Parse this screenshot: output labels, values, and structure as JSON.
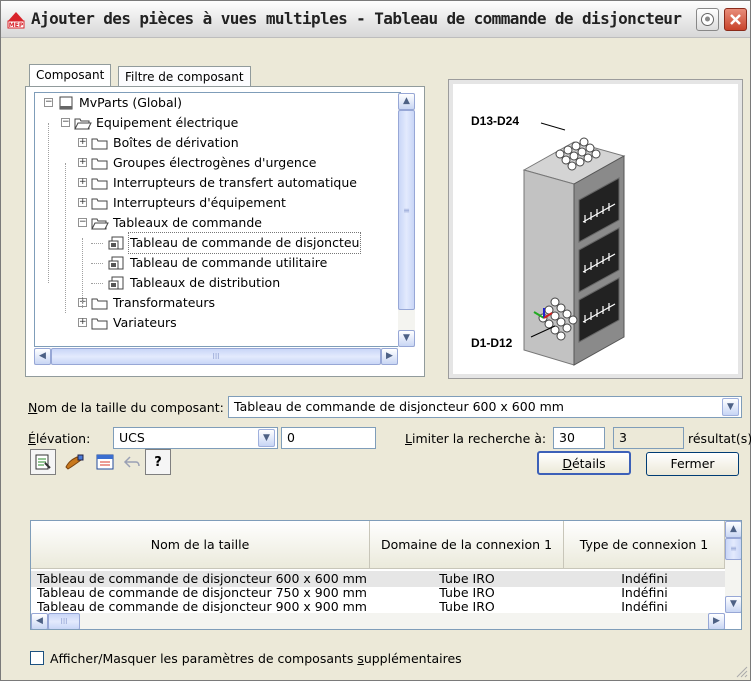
{
  "window": {
    "title": "Ajouter des pièces à vues multiples - Tableau de commande de disjoncteur",
    "app_badge": "MEP"
  },
  "tabs": [
    {
      "label": "Composant",
      "selected": true
    },
    {
      "label": "Filtre de composant",
      "selected": false
    }
  ],
  "tree": {
    "nodes": [
      {
        "label": "MvParts (Global)",
        "depth": 0,
        "expander": "minus",
        "icon": "drive-icon"
      },
      {
        "label": "Equipement électrique",
        "depth": 1,
        "expander": "minus",
        "icon": "folder-open-icon"
      },
      {
        "label": "Boîtes de dérivation",
        "depth": 2,
        "expander": "plus",
        "icon": "folder-icon"
      },
      {
        "label": "Groupes électrogènes d'urgence",
        "depth": 2,
        "expander": "plus",
        "icon": "folder-icon"
      },
      {
        "label": "Interrupteurs de transfert automatique",
        "depth": 2,
        "expander": "plus",
        "icon": "folder-icon"
      },
      {
        "label": "Interrupteurs d'équipement",
        "depth": 2,
        "expander": "plus",
        "icon": "folder-icon"
      },
      {
        "label": "Tableaux de commande",
        "depth": 2,
        "expander": "minus",
        "icon": "folder-open-icon"
      },
      {
        "label": "Tableau de commande de disjoncteu",
        "depth": 3,
        "expander": "",
        "icon": "part-icon",
        "selected": true
      },
      {
        "label": "Tableau de commande utilitaire",
        "depth": 3,
        "expander": "",
        "icon": "part-icon"
      },
      {
        "label": "Tableaux de distribution",
        "depth": 3,
        "expander": "",
        "icon": "part-icon"
      },
      {
        "label": "Transformateurs",
        "depth": 2,
        "expander": "plus",
        "icon": "folder-icon"
      },
      {
        "label": "Variateurs",
        "depth": 2,
        "expander": "plus",
        "icon": "folder-icon"
      }
    ],
    "hscroll_grip": "III"
  },
  "preview": {
    "top_label": "D13-D24",
    "bottom_label": "D1-D12"
  },
  "size": {
    "label_u": "N",
    "label_rest": "om de la taille du composant:",
    "value": "Tableau de commande de disjoncteur 600 x 600 mm"
  },
  "elevation": {
    "label_u": "É",
    "label_rest": "lévation:",
    "ucs_value": "UCS",
    "value": "0"
  },
  "search": {
    "label_u": "L",
    "label_rest": "imiter la recherche à:",
    "limit": "30",
    "count": "3",
    "result_label": "résultat(s)"
  },
  "buttons": {
    "details_u": "D",
    "details_rest": "étails",
    "close": "Fermer"
  },
  "toolbar_icons": [
    "catalog-icon",
    "paint-brush-icon",
    "properties-icon",
    "undo-icon",
    "help-icon"
  ],
  "grid": {
    "columns": [
      "Nom de la taille",
      "Domaine de la connexion 1",
      "Type de connexion 1"
    ],
    "rows": [
      [
        "Tableau de commande de disjoncteur 600 x 600 mm",
        "Tube IRO",
        "Indéfini"
      ],
      [
        "Tableau de commande de disjoncteur 750 x 900 mm",
        "Tube IRO",
        "Indéfini"
      ],
      [
        "Tableau de commande de disjoncteur 900 x 900 mm",
        "Tube IRO",
        "Indéfini"
      ]
    ],
    "hscroll_grip": "III"
  },
  "footer": {
    "checkbox_before": "Afficher/Masquer les paramètres de composants ",
    "checkbox_u": "s",
    "checkbox_after": "upplémentaires",
    "checked": false
  }
}
